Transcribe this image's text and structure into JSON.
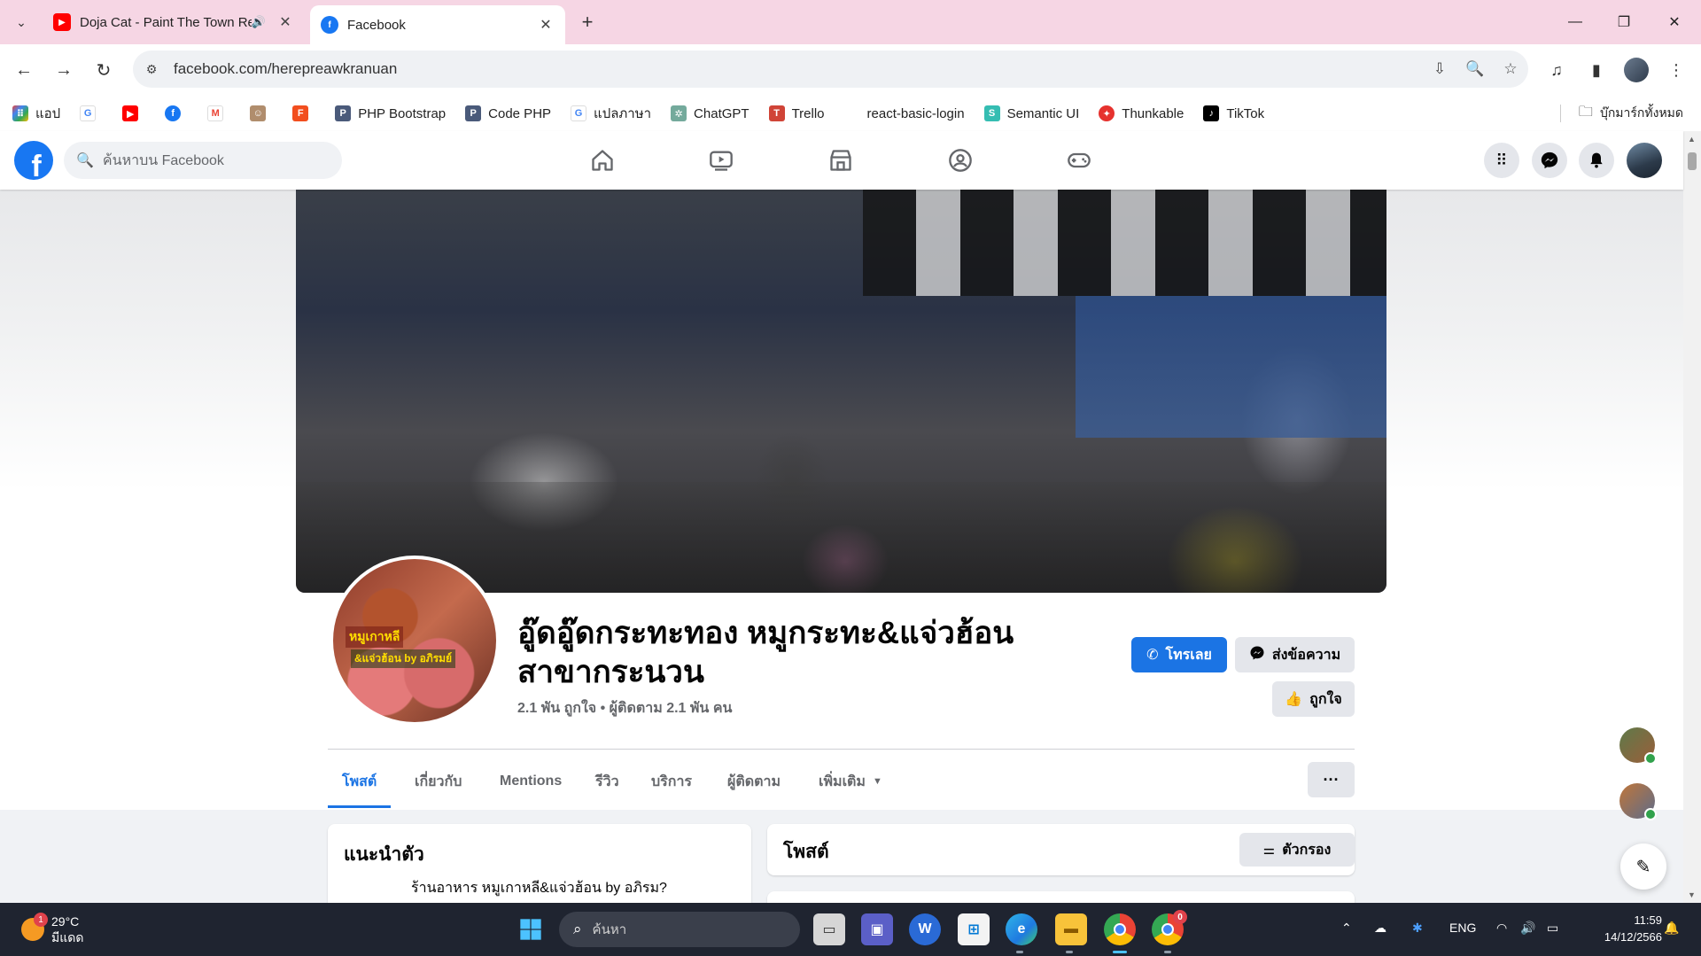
{
  "browser": {
    "tabs": [
      {
        "title": "Doja Cat - Paint The Town Red",
        "favicon": "youtube-icon",
        "audio": true,
        "active": false
      },
      {
        "title": "Facebook",
        "favicon": "facebook-icon",
        "active": true
      }
    ],
    "url": "facebook.com/herepreawkranuan",
    "bookmarks": [
      {
        "label": "แอป",
        "icon": "apps-grid-icon"
      },
      {
        "label": "",
        "icon": "google-icon"
      },
      {
        "label": "",
        "icon": "youtube-icon"
      },
      {
        "label": "",
        "icon": "facebook-icon"
      },
      {
        "label": "",
        "icon": "gmail-icon"
      },
      {
        "label": "",
        "icon": "avatar-icon"
      },
      {
        "label": "",
        "icon": "figma-icon"
      },
      {
        "label": "PHP Bootstrap",
        "icon": "php-icon"
      },
      {
        "label": "Code PHP",
        "icon": "php-icon"
      },
      {
        "label": "แปลภาษา",
        "icon": "google-icon"
      },
      {
        "label": "ChatGPT",
        "icon": "chatgpt-icon"
      },
      {
        "label": "Trello",
        "icon": "trello-icon"
      },
      {
        "label": "react-basic-login",
        "icon": ""
      },
      {
        "label": "Semantic UI",
        "icon": "semantic-icon"
      },
      {
        "label": "Thunkable",
        "icon": "thunkable-icon"
      },
      {
        "label": "TikTok",
        "icon": "tiktok-icon"
      }
    ],
    "all_bookmarks": "บุ๊กมาร์กทั้งหมด"
  },
  "facebook": {
    "search_placeholder": "ค้นหาบน Facebook",
    "page": {
      "name": "อู๊ดอู๊ดกระทะทอง หมูกระทะ&แจ่วฮ้อน สาขากระนวน",
      "stats": "2.1 พัน ถูกใจ • ผู้ติดตาม 2.1 พัน คน",
      "avatar_text_1": "หมูเกาหลี",
      "avatar_text_2": "&แจ่วฮ้อน by อภิรมย์",
      "call_button": "โทรเลย",
      "message_button": "ส่งข้อความ",
      "like_button": "ถูกใจ"
    },
    "tabs": [
      "โพสต์",
      "เกี่ยวกับ",
      "Mentions",
      "รีวิว",
      "บริการ",
      "ผู้ติดตาม",
      "เพิ่มเติม"
    ],
    "active_tab": "โพสต์",
    "more_dots": "···",
    "intro": {
      "title": "แนะนำตัว",
      "text": "ร้านอาหาร หมูเกาหลี&แจ่วฮ้อน by อภิรม?"
    },
    "posts": {
      "title": "โพสต์",
      "filter_button": "ตัวกรอง"
    }
  },
  "taskbar": {
    "weather_temp": "29°C",
    "weather_desc": "มีแดด",
    "weather_badge": "1",
    "search_placeholder": "ค้นหา",
    "lang": "ENG",
    "time": "11:59",
    "date": "14/12/2566",
    "chrome_badge": "0"
  },
  "colors": {
    "tab_strip": "#f6d6e4",
    "fb_blue": "#1877f2",
    "taskbar": "#1f2430"
  }
}
